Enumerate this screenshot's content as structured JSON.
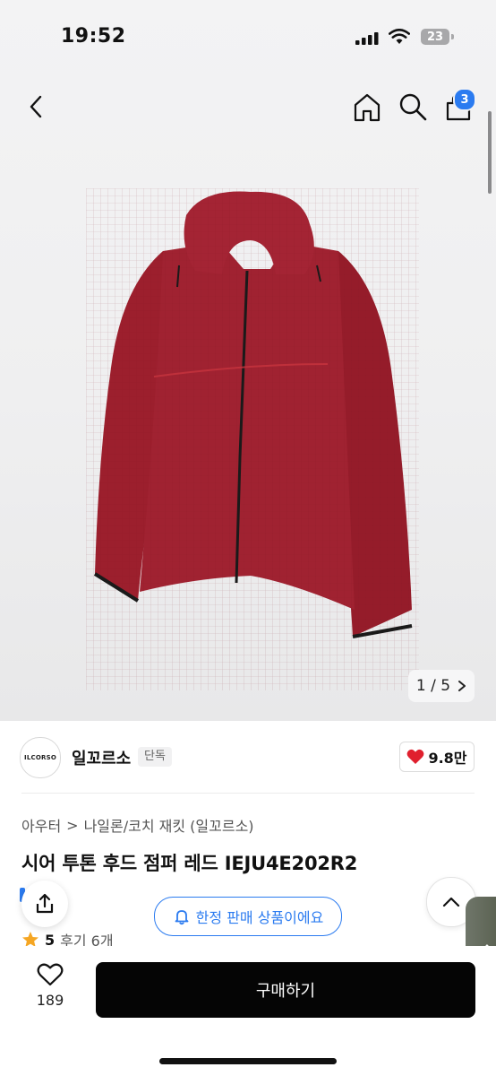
{
  "status_bar": {
    "time": "19:52",
    "battery": "23"
  },
  "nav": {
    "cart_count": "3"
  },
  "gallery": {
    "current": "1",
    "separator": "/",
    "total": "5"
  },
  "brand": {
    "logo_text": "ILCORSO",
    "name": "일꼬르소",
    "badge": "단독"
  },
  "likes": {
    "count": "9.8만"
  },
  "breadcrumb": {
    "root": "아우터",
    "separator": ">",
    "leaf": "나일론/코치 재킷 (일꼬르소)"
  },
  "product": {
    "title": "시어 투톤 후드 점퍼 레드 IEJU4E202R2"
  },
  "notice": {
    "limited_label": "한정 판매 상품이에요"
  },
  "rating": {
    "score": "5",
    "reviews_label": "후기 6개"
  },
  "bottom": {
    "wish_count": "189",
    "buy_label": "구매하기"
  },
  "colors": {
    "accent": "#2b7bf0",
    "buy_button": "#050505",
    "heart": "#e0202e",
    "star": "#f5a623",
    "jacket": "#9a1f2c"
  }
}
